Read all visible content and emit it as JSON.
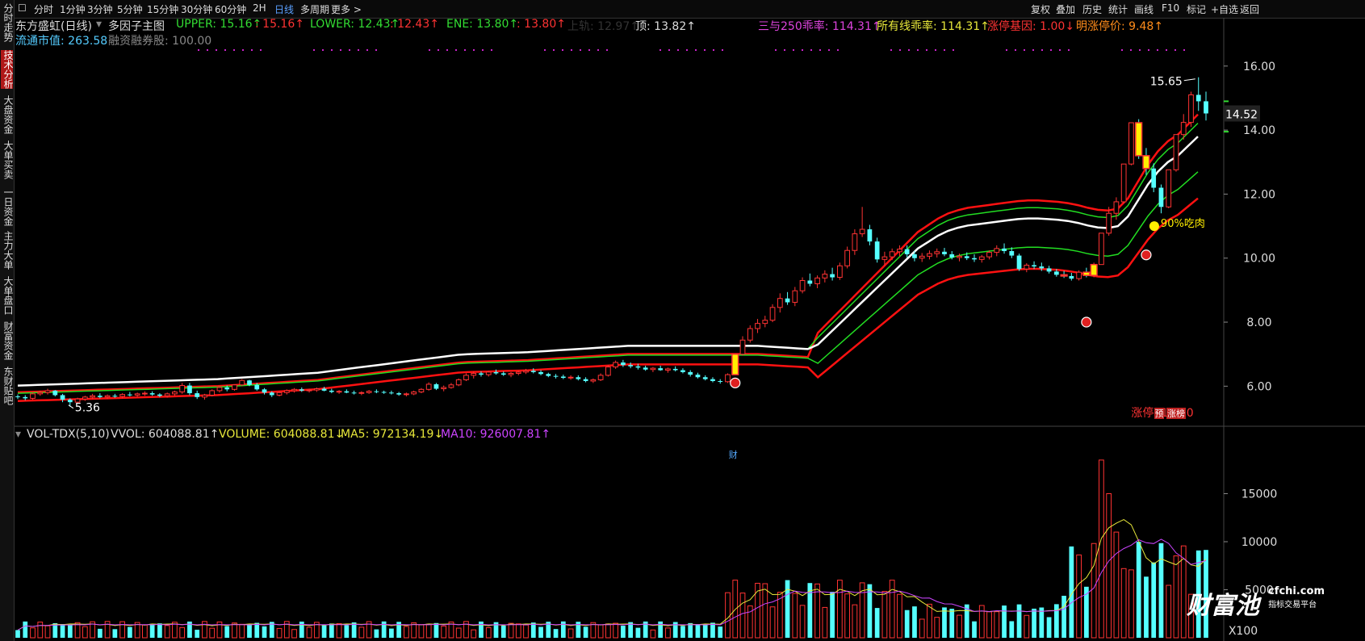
{
  "toolbar": {
    "periods": [
      "分时",
      "1分钟",
      "3分钟",
      "5分钟",
      "15分钟",
      "30分钟",
      "60分钟",
      "2H",
      "日线",
      "多周期",
      "更多 >"
    ],
    "active_period": "日线",
    "right_buttons": [
      "复权",
      "叠加",
      "历史",
      "统计",
      "画线",
      "F10",
      "标记",
      "+自选",
      "返回"
    ]
  },
  "sidebar": {
    "items": [
      "分时走势",
      "技术分析",
      "大盘资金",
      "大单买卖",
      "一日资金",
      "主力大单",
      "大单盘口",
      "财富资金",
      "东财贴吧"
    ],
    "active": "技术分析"
  },
  "header": {
    "stock": "东方盛虹(日线)",
    "indicator_name": "多因子主图",
    "upper": "UPPER: 15.16↑",
    "upper2": ": 15.16↑",
    "lower": "LOWER: 12.43↑",
    "lower2": ": 12.43↑",
    "ene": "ENE: 13.80↑",
    "ene2": ": 13.80↑",
    "shangui": "上轨: 12.97↑",
    "ding": "顶: 13.82↑",
    "ma250": "三与250乖率: 114.31↑",
    "allma": "所有线乖率: 114.31↑",
    "zt_gene": "涨停基因: 1.00↓",
    "next_zt": "明涨停价: 9.48↑",
    "float_cap": "流通市值: 263.58",
    "margin": "融资融券股: 100.00"
  },
  "vol_header": {
    "name": "VOL-TDX(5,10)",
    "vvol": "VVOL: 604088.81↑",
    "volume": "VOLUME: 604088.81↓",
    "ma5": "MA5: 972134.19↓",
    "ma10": "MA10: 926007.81↑"
  },
  "annotations": {
    "high": "15.65",
    "low": "5.36",
    "eat": "90%吃肉",
    "limit_up": "涨停: 16.80",
    "cai": "财",
    "yu": "预",
    "zhangbang": "涨榜",
    "current_price": "14.52"
  },
  "logo": {
    "text": "财富池",
    "site": "cfchi.com",
    "tagline": "指标交易平台"
  },
  "colors": {
    "up": "#ff3333",
    "down": "#55ffff",
    "white_line": "#ffffff",
    "green_line": "#22dd22",
    "red_line": "#ff1111",
    "ma5": "#e8e83a",
    "ma10": "#cc44ff",
    "signal": "#ffee00"
  },
  "chart_data": [
    {
      "type": "candlestick",
      "title": "东方盛虹(日线)",
      "y_ticks": [
        6,
        8,
        10,
        12,
        14,
        16
      ],
      "ylim": [
        5.0,
        16.5
      ],
      "ohlc": [
        [
          5.68,
          5.74,
          5.6,
          5.66
        ],
        [
          5.66,
          5.72,
          5.56,
          5.62
        ],
        [
          5.62,
          5.8,
          5.58,
          5.76
        ],
        [
          5.76,
          5.86,
          5.7,
          5.8
        ],
        [
          5.8,
          5.92,
          5.74,
          5.86
        ],
        [
          5.86,
          5.88,
          5.68,
          5.72
        ],
        [
          5.72,
          5.76,
          5.5,
          5.58
        ],
        [
          5.58,
          5.62,
          5.36,
          5.5
        ],
        [
          5.5,
          5.64,
          5.46,
          5.6
        ],
        [
          5.6,
          5.7,
          5.54,
          5.66
        ],
        [
          5.66,
          5.76,
          5.6,
          5.7
        ],
        [
          5.7,
          5.78,
          5.62,
          5.66
        ],
        [
          5.66,
          5.74,
          5.6,
          5.7
        ],
        [
          5.7,
          5.76,
          5.64,
          5.68
        ],
        [
          5.68,
          5.78,
          5.62,
          5.74
        ],
        [
          5.74,
          5.82,
          5.68,
          5.72
        ],
        [
          5.72,
          5.8,
          5.66,
          5.76
        ],
        [
          5.76,
          5.84,
          5.7,
          5.78
        ],
        [
          5.78,
          5.84,
          5.7,
          5.74
        ],
        [
          5.74,
          5.78,
          5.66,
          5.7
        ],
        [
          5.7,
          5.8,
          5.64,
          5.76
        ],
        [
          5.76,
          5.86,
          5.7,
          5.82
        ],
        [
          5.82,
          6.1,
          5.76,
          6.02
        ],
        [
          6.02,
          6.1,
          5.72,
          5.78
        ],
        [
          5.78,
          5.86,
          5.6,
          5.66
        ],
        [
          5.66,
          5.76,
          5.58,
          5.72
        ],
        [
          5.72,
          5.9,
          5.68,
          5.86
        ],
        [
          5.86,
          6.0,
          5.8,
          5.96
        ],
        [
          5.96,
          6.02,
          5.84,
          5.9
        ],
        [
          5.9,
          6.06,
          5.86,
          6.04
        ],
        [
          6.04,
          6.22,
          6.0,
          6.18
        ],
        [
          6.18,
          6.2,
          6.0,
          6.04
        ],
        [
          6.04,
          6.1,
          5.86,
          5.9
        ],
        [
          5.9,
          5.94,
          5.74,
          5.8
        ],
        [
          5.8,
          5.84,
          5.66,
          5.72
        ],
        [
          5.72,
          5.84,
          5.68,
          5.8
        ],
        [
          5.8,
          5.9,
          5.74,
          5.86
        ],
        [
          5.86,
          5.94,
          5.8,
          5.9
        ],
        [
          5.9,
          5.96,
          5.82,
          5.86
        ],
        [
          5.86,
          5.92,
          5.8,
          5.88
        ],
        [
          5.88,
          5.96,
          5.82,
          5.92
        ],
        [
          5.92,
          5.98,
          5.84,
          5.86
        ],
        [
          5.86,
          5.92,
          5.78,
          5.82
        ],
        [
          5.82,
          5.88,
          5.76,
          5.84
        ],
        [
          5.84,
          5.9,
          5.78,
          5.8
        ],
        [
          5.8,
          5.86,
          5.74,
          5.78
        ],
        [
          5.78,
          5.84,
          5.72,
          5.8
        ],
        [
          5.8,
          5.88,
          5.76,
          5.84
        ],
        [
          5.84,
          5.9,
          5.78,
          5.82
        ],
        [
          5.82,
          5.86,
          5.76,
          5.8
        ],
        [
          5.8,
          5.86,
          5.74,
          5.78
        ],
        [
          5.78,
          5.82,
          5.7,
          5.74
        ],
        [
          5.74,
          5.8,
          5.68,
          5.76
        ],
        [
          5.76,
          5.86,
          5.72,
          5.82
        ],
        [
          5.82,
          5.94,
          5.78,
          5.9
        ],
        [
          5.9,
          6.12,
          5.86,
          6.06
        ],
        [
          6.06,
          6.1,
          5.88,
          5.92
        ],
        [
          5.92,
          6.02,
          5.84,
          5.96
        ],
        [
          5.96,
          6.1,
          5.92,
          6.04
        ],
        [
          6.04,
          6.24,
          6.0,
          6.2
        ],
        [
          6.2,
          6.4,
          6.16,
          6.34
        ],
        [
          6.34,
          6.46,
          6.24,
          6.4
        ],
        [
          6.4,
          6.46,
          6.3,
          6.36
        ],
        [
          6.36,
          6.48,
          6.3,
          6.44
        ],
        [
          6.44,
          6.52,
          6.36,
          6.4
        ],
        [
          6.4,
          6.46,
          6.32,
          6.36
        ],
        [
          6.36,
          6.44,
          6.28,
          6.4
        ],
        [
          6.4,
          6.48,
          6.34,
          6.44
        ],
        [
          6.44,
          6.54,
          6.38,
          6.48
        ],
        [
          6.48,
          6.56,
          6.4,
          6.44
        ],
        [
          6.44,
          6.5,
          6.34,
          6.38
        ],
        [
          6.38,
          6.42,
          6.28,
          6.32
        ],
        [
          6.32,
          6.38,
          6.24,
          6.3
        ],
        [
          6.3,
          6.36,
          6.22,
          6.26
        ],
        [
          6.26,
          6.34,
          6.2,
          6.28
        ],
        [
          6.28,
          6.34,
          6.18,
          6.22
        ],
        [
          6.22,
          6.28,
          6.12,
          6.16
        ],
        [
          6.16,
          6.24,
          6.1,
          6.2
        ],
        [
          6.2,
          6.4,
          6.16,
          6.34
        ],
        [
          6.34,
          6.66,
          6.3,
          6.6
        ],
        [
          6.6,
          6.8,
          6.54,
          6.74
        ],
        [
          6.74,
          6.82,
          6.6,
          6.66
        ],
        [
          6.66,
          6.74,
          6.56,
          6.62
        ],
        [
          6.62,
          6.7,
          6.52,
          6.58
        ],
        [
          6.58,
          6.64,
          6.48,
          6.52
        ],
        [
          6.52,
          6.6,
          6.44,
          6.56
        ],
        [
          6.56,
          6.64,
          6.48,
          6.5
        ],
        [
          6.5,
          6.58,
          6.42,
          6.54
        ],
        [
          6.54,
          6.62,
          6.46,
          6.5
        ],
        [
          6.5,
          6.56,
          6.4,
          6.44
        ],
        [
          6.44,
          6.5,
          6.3,
          6.36
        ],
        [
          6.36,
          6.42,
          6.24,
          6.28
        ],
        [
          6.28,
          6.34,
          6.18,
          6.22
        ],
        [
          6.22,
          6.28,
          6.12,
          6.16
        ],
        [
          6.16,
          6.22,
          6.08,
          6.14
        ],
        [
          6.14,
          6.4,
          6.1,
          6.36
        ],
        [
          6.36,
          7.0,
          6.36,
          7.0
        ],
        [
          7.0,
          7.56,
          6.96,
          7.44
        ],
        [
          7.44,
          7.9,
          7.36,
          7.8
        ],
        [
          7.8,
          8.1,
          7.66,
          7.96
        ],
        [
          7.96,
          8.2,
          7.84,
          8.06
        ],
        [
          8.06,
          8.56,
          8.0,
          8.46
        ],
        [
          8.46,
          8.9,
          8.3,
          8.74
        ],
        [
          8.74,
          8.94,
          8.54,
          8.62
        ],
        [
          8.62,
          9.1,
          8.5,
          8.98
        ],
        [
          8.98,
          9.4,
          8.9,
          9.3
        ],
        [
          9.3,
          9.52,
          9.12,
          9.2
        ],
        [
          9.2,
          9.46,
          9.06,
          9.38
        ],
        [
          9.38,
          9.62,
          9.24,
          9.5
        ],
        [
          9.5,
          9.7,
          9.3,
          9.4
        ],
        [
          9.4,
          9.86,
          9.32,
          9.76
        ],
        [
          9.76,
          10.36,
          9.68,
          10.24
        ],
        [
          10.24,
          10.9,
          10.1,
          10.76
        ],
        [
          10.76,
          11.6,
          10.66,
          10.9
        ],
        [
          10.9,
          11.04,
          10.4,
          10.52
        ],
        [
          10.52,
          10.64,
          9.86,
          9.96
        ],
        [
          9.96,
          10.2,
          9.76,
          10.04
        ],
        [
          10.04,
          10.3,
          9.94,
          10.2
        ],
        [
          10.2,
          10.4,
          10.06,
          10.28
        ],
        [
          10.28,
          10.4,
          10.02,
          10.12
        ],
        [
          10.12,
          10.22,
          9.9,
          10.0
        ],
        [
          10.0,
          10.16,
          9.88,
          10.06
        ],
        [
          10.06,
          10.24,
          9.96,
          10.14
        ],
        [
          10.14,
          10.3,
          10.02,
          10.2
        ],
        [
          10.2,
          10.32,
          10.06,
          10.12
        ],
        [
          10.12,
          10.22,
          9.96,
          10.02
        ],
        [
          10.02,
          10.14,
          9.9,
          10.06
        ],
        [
          10.06,
          10.18,
          9.94,
          10.0
        ],
        [
          10.0,
          10.12,
          9.88,
          9.96
        ],
        [
          9.96,
          10.1,
          9.86,
          10.04
        ],
        [
          10.04,
          10.24,
          9.96,
          10.18
        ],
        [
          10.18,
          10.4,
          10.06,
          10.3
        ],
        [
          10.3,
          10.46,
          10.14,
          10.22
        ],
        [
          10.22,
          10.34,
          10.0,
          10.08
        ],
        [
          10.08,
          10.14,
          9.6,
          9.66
        ],
        [
          9.66,
          9.84,
          9.56,
          9.78
        ],
        [
          9.78,
          9.9,
          9.66,
          9.74
        ],
        [
          9.74,
          9.86,
          9.6,
          9.68
        ],
        [
          9.68,
          9.76,
          9.52,
          9.58
        ],
        [
          9.58,
          9.66,
          9.42,
          9.48
        ],
        [
          9.48,
          9.6,
          9.38,
          9.44
        ],
        [
          9.44,
          9.54,
          9.3,
          9.36
        ],
        [
          9.36,
          9.62,
          9.3,
          9.56
        ],
        [
          9.56,
          9.7,
          9.4,
          9.46
        ],
        [
          9.46,
          9.86,
          9.4,
          9.8
        ],
        [
          9.8,
          10.78,
          9.8,
          10.78
        ],
        [
          10.78,
          11.6,
          10.7,
          11.4
        ],
        [
          11.4,
          11.9,
          11.2,
          11.76
        ],
        [
          11.76,
          12.94,
          11.7,
          12.94
        ],
        [
          12.94,
          14.23,
          12.9,
          14.23
        ],
        [
          14.23,
          14.34,
          13.1,
          13.2
        ],
        [
          13.2,
          13.44,
          12.6,
          12.8
        ],
        [
          12.8,
          12.96,
          12.06,
          12.2
        ],
        [
          12.2,
          12.3,
          11.4,
          11.6
        ],
        [
          11.6,
          12.76,
          11.56,
          12.76
        ],
        [
          12.76,
          13.86,
          12.7,
          13.86
        ],
        [
          13.86,
          14.5,
          13.7,
          14.24
        ],
        [
          14.24,
          15.2,
          14.1,
          15.1
        ],
        [
          15.1,
          15.65,
          14.6,
          14.9
        ],
        [
          14.9,
          15.2,
          14.3,
          14.52
        ]
      ],
      "zt_days": [
        96,
        140,
        143,
        144,
        150,
        151
      ],
      "lines": {
        "white_ma": [
          6.02,
          6.03,
          6.04,
          6.05,
          6.06,
          6.07,
          6.08,
          6.09,
          6.1,
          6.11,
          6.12,
          6.13,
          6.14,
          6.15,
          6.16,
          6.17,
          6.18,
          6.19,
          6.2,
          6.21,
          6.22,
          6.24,
          6.26,
          6.28,
          6.3,
          6.32,
          6.34,
          6.36,
          6.38,
          6.4,
          6.42,
          6.46,
          6.5,
          6.54,
          6.58,
          6.62,
          6.66,
          6.7,
          6.74,
          6.78,
          6.82,
          6.86,
          6.9,
          6.94,
          6.98,
          7.0,
          7.01,
          7.02,
          7.03,
          7.04,
          7.05,
          7.06,
          7.08,
          7.1,
          7.12,
          7.14,
          7.16,
          7.18,
          7.2,
          7.22,
          7.24,
          7.26,
          7.26,
          7.26,
          7.26,
          7.26,
          7.26,
          7.26,
          7.26,
          7.26,
          7.26,
          7.26,
          7.26,
          7.26,
          7.26,
          7.24,
          7.22,
          7.2,
          7.18,
          7.16,
          7.3,
          7.6,
          7.9,
          8.2,
          8.5,
          8.8,
          9.1,
          9.4,
          9.7,
          10.0,
          10.3,
          10.5,
          10.7,
          10.85,
          10.95,
          11.02,
          11.06,
          11.1,
          11.14,
          11.18,
          11.22,
          11.24,
          11.24,
          11.22,
          11.2,
          11.16,
          11.1,
          11.02,
          10.96,
          10.94,
          11.0,
          11.3,
          11.8,
          12.3,
          12.7,
          13.0,
          13.2,
          13.5,
          13.8
        ]
      }
    },
    {
      "type": "bar",
      "title": "VOL-TDX(5,10)",
      "y_ticks": [
        5000,
        10000,
        15000
      ],
      "unit": "X100",
      "ylim": [
        0,
        20000
      ]
    }
  ]
}
